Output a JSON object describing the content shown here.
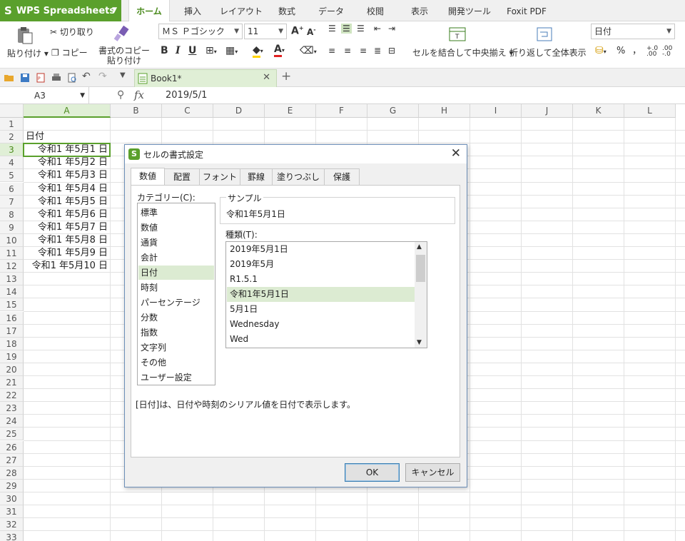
{
  "app": {
    "name": "WPS Spreadsheets",
    "logo": "S"
  },
  "menu_tabs": [
    "ホーム",
    "挿入",
    "レイアウト",
    "数式",
    "データ",
    "校閲",
    "表示",
    "開発ツール",
    "Foxit PDF"
  ],
  "ribbon": {
    "paste": "貼り付け",
    "cut": "切り取り",
    "copy": "コピー",
    "format_painter_1": "書式のコピー",
    "format_painter_2": "貼り付け",
    "font_name": "ＭＳ Ｐゴシック",
    "font_size": "11",
    "merge_center": "セルを結合して中央揃え",
    "wrap_text": "折り返して全体表示",
    "number_format": "日付",
    "percent": "%",
    "comma": "，"
  },
  "doc_tab": {
    "title": "Book1*"
  },
  "formula_bar": {
    "name_box": "A3",
    "fx": "fx",
    "value": "2019/5/1"
  },
  "columns": [
    "A",
    "B",
    "C",
    "D",
    "E",
    "F",
    "G",
    "H",
    "I",
    "J",
    "K",
    "L"
  ],
  "rows": [
    "1",
    "2",
    "3",
    "4",
    "5",
    "6",
    "7",
    "8",
    "9",
    "10",
    "11",
    "12",
    "13",
    "14",
    "15",
    "16",
    "17",
    "18",
    "19",
    "20",
    "21",
    "22",
    "23",
    "24",
    "25",
    "26",
    "27",
    "28",
    "29",
    "30",
    "31",
    "32",
    "33"
  ],
  "cells": {
    "a2": "日付",
    "dates": [
      "令和1 年5月1 日",
      "令和1 年5月2 日",
      "令和1 年5月3 日",
      "令和1 年5月4 日",
      "令和1 年5月5 日",
      "令和1 年5月6 日",
      "令和1 年5月7 日",
      "令和1 年5月8 日",
      "令和1 年5月9 日",
      "令和1 年5月10 日"
    ]
  },
  "dialog": {
    "title": "セルの書式設定",
    "tabs": [
      "数値",
      "配置",
      "フォント",
      "罫線",
      "塗りつぶし",
      "保護"
    ],
    "category_label": "カテゴリー(C):",
    "categories": [
      "標準",
      "数値",
      "通貨",
      "会計",
      "日付",
      "時刻",
      "パーセンテージ",
      "分数",
      "指数",
      "文字列",
      "その他",
      "ユーザー設定"
    ],
    "sample_label": "サンプル",
    "sample_value": "令和1年5月1日",
    "type_label": "種類(T):",
    "types": [
      "2019年5月1日",
      "2019年5月",
      "R1.5.1",
      "令和1年5月1日",
      "5月1日",
      "Wednesday",
      "Wed"
    ],
    "description": "[日付]は、日付や時刻のシリアル値を日付で表示します。",
    "ok": "OK",
    "cancel": "キャンセル"
  }
}
